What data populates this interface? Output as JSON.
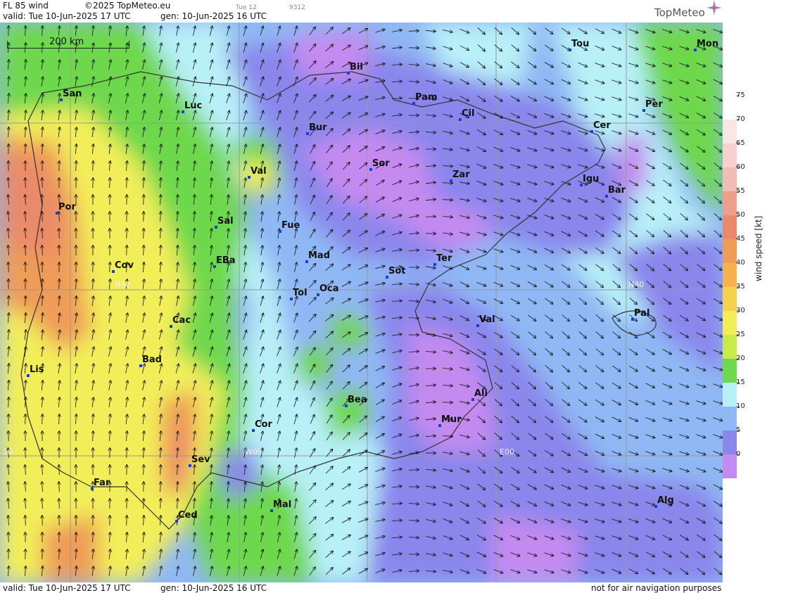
{
  "header": {
    "product": "FL 85 wind",
    "copyright": "©2025 TopMeteo.eu",
    "step": "Tue 12",
    "code": "9312",
    "valid": "valid:  Tue  10-Jun-2025  17 UTC",
    "gen": "gen: 10-Jun-2025 16 UTC",
    "brand": "TopMeteo"
  },
  "footer": {
    "valid": "valid:  Tue  10-Jun-2025  17 UTC",
    "gen": "gen: 10-Jun-2025 16 UTC",
    "disclaimer": "not for air navigation purposes"
  },
  "scale_bar": "200 km",
  "grid_labels": [
    "N40",
    "N40",
    "W05",
    "E00",
    "10"
  ],
  "cities": [
    "Tou",
    "Mon",
    "Bil",
    "Pam",
    "Cil",
    "San",
    "Luc",
    "Per",
    "Bur",
    "Cer",
    "Sor",
    "Zar",
    "Igu",
    "Bar",
    "Val",
    "Por",
    "Sal",
    "Fue",
    "Mad",
    "Cov",
    "EBa",
    "Sot",
    "Ter",
    "Tol",
    "Oca",
    "Pal",
    "Cac",
    "Val",
    "Bad",
    "Lis",
    "Ali",
    "Bea",
    "Mur",
    "Cor",
    "Sev",
    "Far",
    "Mal",
    "Alg",
    "Ced"
  ],
  "legend": {
    "title": "wind speed  [kt]",
    "ticks": [
      "75",
      "70",
      "65",
      "60",
      "55",
      "50",
      "45",
      "40",
      "35",
      "30",
      "25",
      "20",
      "15",
      "10",
      "5",
      "0"
    ],
    "colors": [
      "#ffffff",
      "#fbe6e6",
      "#f6d1cf",
      "#f2bcb6",
      "#ee9f8c",
      "#ea8a6a",
      "#ef9c58",
      "#f6b24e",
      "#f5d24e",
      "#f2ee5a",
      "#c8ea4a",
      "#6ed84e",
      "#b8f0f8",
      "#8fb8f4",
      "#8a86ec",
      "#c48af0"
    ]
  }
}
